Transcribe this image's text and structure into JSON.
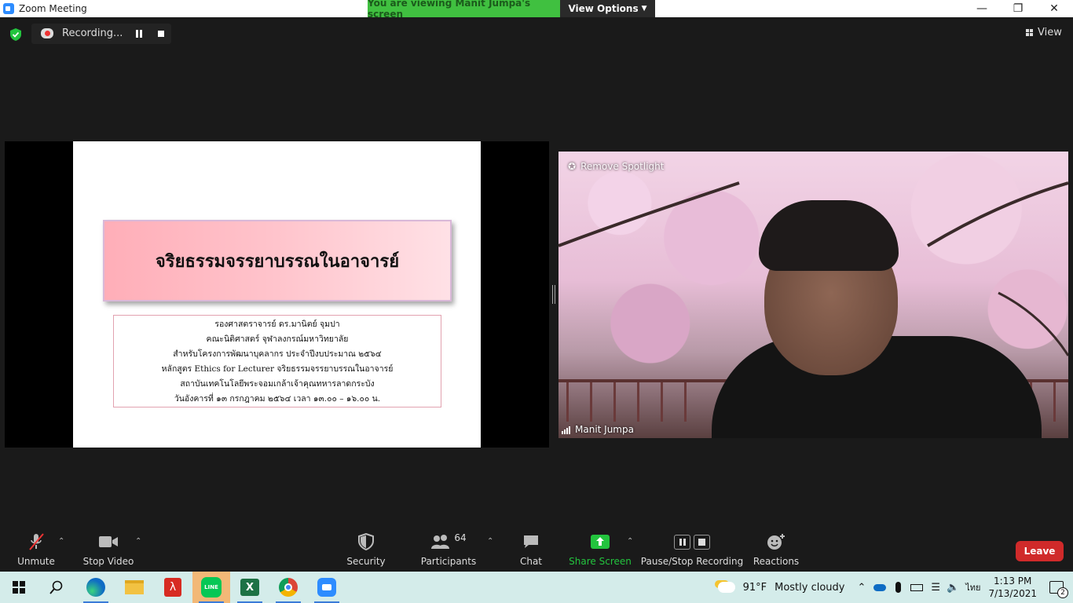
{
  "window": {
    "title": "Zoom Meeting"
  },
  "banner": {
    "viewing": "You are viewing Manit Jumpa's screen",
    "view_options": "View Options"
  },
  "recording": {
    "status": "Recording..."
  },
  "top_right": {
    "view_label": "View"
  },
  "slide": {
    "title": "จริยธรรมจรรยาบรรณในอาจารย์",
    "lines": [
      "รองศาสตราจารย์ ดร.มานิตย์ จุมปา",
      "คณะนิติศาสตร์ จุฬาลงกรณ์มหาวิทยาลัย",
      "สำหรับโครงการพัฒนาบุคลากร ประจำปีงบประมาณ ๒๕๖๔",
      "หลักสูตร Ethics for Lecturer จริยธรรมจรรยาบรรณในอาจารย์",
      "สถาบันเทคโนโลยีพระจอมเกล้าเจ้าคุณทหารลาดกระบัง",
      "วันอังคารที่ ๑๓ กรกฎาคม ๒๕๖๔ เวลา ๑๓.๐๐ – ๑๖.๐๐ น."
    ]
  },
  "video": {
    "spotlight_label": "Remove Spotlight",
    "participant_name": "Manit Jumpa"
  },
  "toolbar": {
    "unmute": "Unmute",
    "stop_video": "Stop Video",
    "security": "Security",
    "participants": "Participants",
    "participants_count": "64",
    "chat": "Chat",
    "share_screen": "Share Screen",
    "pause_stop_recording": "Pause/Stop Recording",
    "reactions": "Reactions",
    "leave": "Leave"
  },
  "taskbar": {
    "weather_temp": "91°F",
    "weather_text": "Mostly cloudy",
    "language": "ไทย",
    "time": "1:13 PM",
    "date": "7/13/2021",
    "notifications": "2",
    "line_app_label": "LINE"
  },
  "colors": {
    "leave": "#d02a2a",
    "share_green": "#23c43e",
    "banner_green": "#40c040",
    "taskbar": "#d4ecea"
  },
  "icons": [
    "zoom-app-icon",
    "shield-check-icon",
    "recording-icon",
    "pause-icon",
    "stop-icon",
    "grid-view-icon",
    "mic-muted-icon",
    "camera-icon",
    "shield-icon",
    "people-icon",
    "chat-icon",
    "share-arrow-icon",
    "record-controls-icon",
    "smiley-icon",
    "windows-start-icon",
    "search-icon",
    "edge-icon",
    "file-explorer-icon",
    "acrobat-icon",
    "line-icon",
    "excel-icon",
    "chrome-icon",
    "zoom-taskbar-icon",
    "weather-icon",
    "chevron-up-icon",
    "onedrive-icon",
    "microphone-icon",
    "battery-icon",
    "wifi-icon",
    "speaker-icon",
    "notification-icon"
  ]
}
